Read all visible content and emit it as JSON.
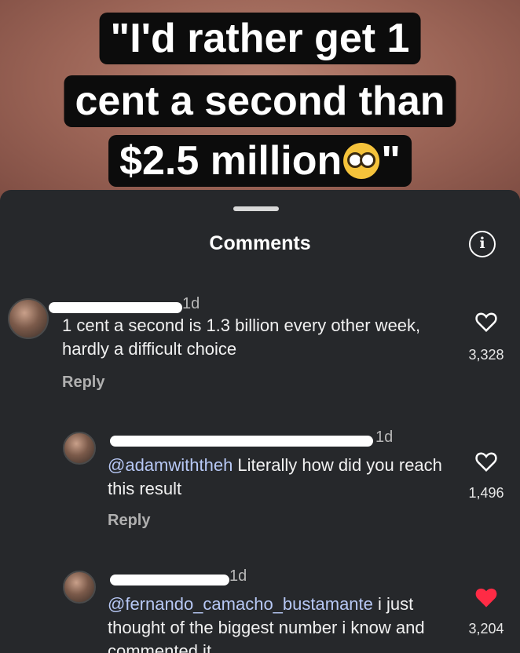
{
  "video": {
    "caption": {
      "line1": "\"I'd rather get 1",
      "line2": "cent a second than",
      "line3_start": "$2.5 million",
      "line3_end": "\""
    },
    "emoji": "nerd-face-emoji"
  },
  "sheet": {
    "title": "Comments",
    "info_icon_label": "i"
  },
  "comments": [
    {
      "username": "[redacted]",
      "time": "1d",
      "mention": "",
      "text": "1 cent a second is 1.3 billion every other week, hardly a difficult choice",
      "reply_label": "Reply",
      "likes": "3,328",
      "liked": false
    },
    {
      "username": "[redacted]",
      "time": "1d",
      "mention": "@adamwiththeh",
      "text": " Literally how did you reach this result",
      "reply_label": "Reply",
      "likes": "1,496",
      "liked": false
    },
    {
      "username": "[redacted]",
      "time": "1d",
      "mention": "@fernando_camacho_bustamante",
      "text": " i just thought of the biggest number i know and commented it",
      "reply_label": "",
      "likes": "3,204",
      "liked": true
    }
  ],
  "colors": {
    "sheet_bg": "#26282b",
    "liked_heart": "#ff2b45",
    "mention": "#b7c8f5"
  }
}
